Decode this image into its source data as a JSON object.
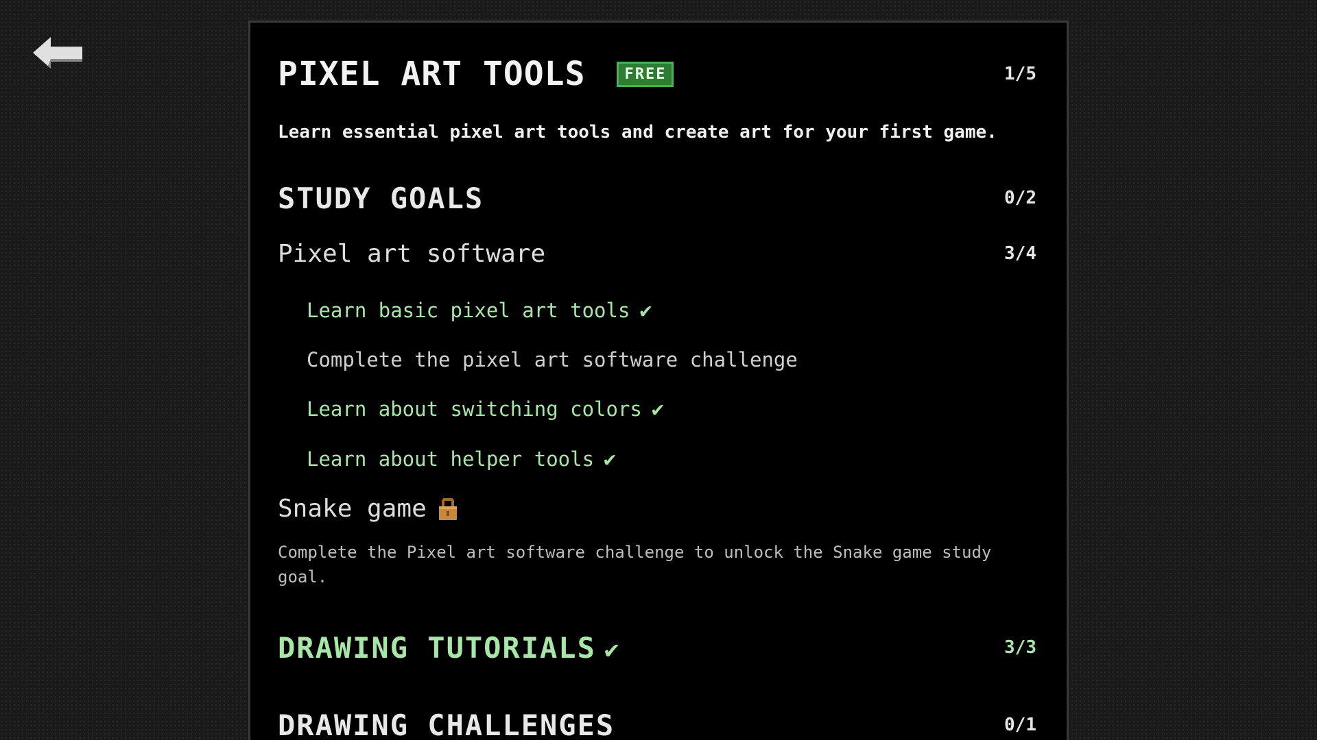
{
  "course": {
    "title": "PIXEL ART TOOLS",
    "badge": "FREE",
    "progress": "1/5",
    "description": "Learn essential pixel art tools and create art for your first game."
  },
  "sections": {
    "study_goals": {
      "title": "STUDY GOALS",
      "progress": "0/2",
      "goals": {
        "pixel_art_software": {
          "title": "Pixel art software",
          "progress": "3/4",
          "tasks": [
            {
              "label": "Learn basic pixel art tools",
              "done": true
            },
            {
              "label": "Complete the pixel art software challenge",
              "done": false
            },
            {
              "label": "Learn about switching colors",
              "done": true
            },
            {
              "label": "Learn about helper tools",
              "done": true
            }
          ]
        },
        "snake_game": {
          "title": "Snake game",
          "locked": true,
          "lock_message": "Complete the Pixel art software challenge to unlock the Snake game study goal."
        }
      }
    },
    "drawing_tutorials": {
      "title": "DRAWING TUTORIALS",
      "progress": "3/3",
      "complete": true
    },
    "drawing_challenges": {
      "title": "DRAWING CHALLENGES",
      "progress": "0/1"
    }
  },
  "check_glyph": "✔",
  "icons": {
    "back": "arrow-left-icon",
    "lock": "lock-icon",
    "check": "check-icon"
  },
  "colors": {
    "complete": "#a8e6a8",
    "badge_bg": "#2e7d32",
    "lock": "#c8873a"
  }
}
